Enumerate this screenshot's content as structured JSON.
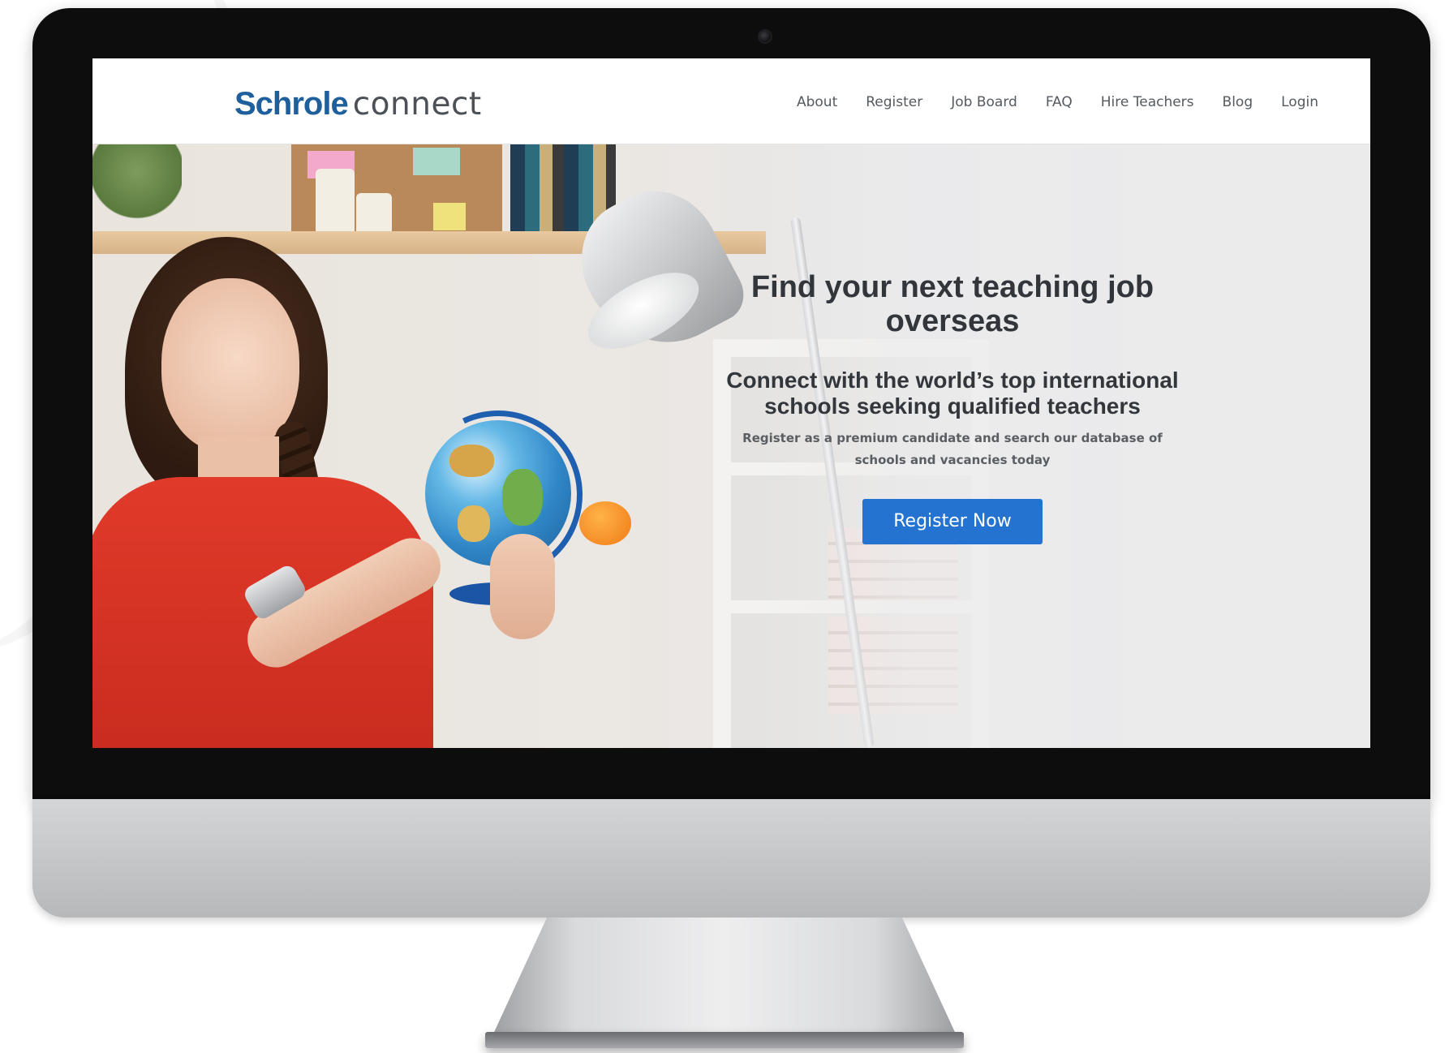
{
  "site": {
    "logo_brand": "Schrole",
    "logo_suffix": "connect",
    "brand_color": "#1f5f9c"
  },
  "nav": {
    "items": [
      "About",
      "Register",
      "Job Board",
      "FAQ",
      "Hire Teachers",
      "Blog",
      "Login"
    ]
  },
  "hero": {
    "title": "Find your next teaching job overseas",
    "subtitle": "Connect with the world’s top international schools seeking qualified teachers",
    "description": "Register as a premium candidate and search our database of schools and vacancies today",
    "cta_label": "Register Now",
    "cta_color": "#2573d0",
    "image_semantic": "teacher-holding-globe-photo"
  },
  "device": {
    "type": "desktop-monitor-mockup"
  }
}
